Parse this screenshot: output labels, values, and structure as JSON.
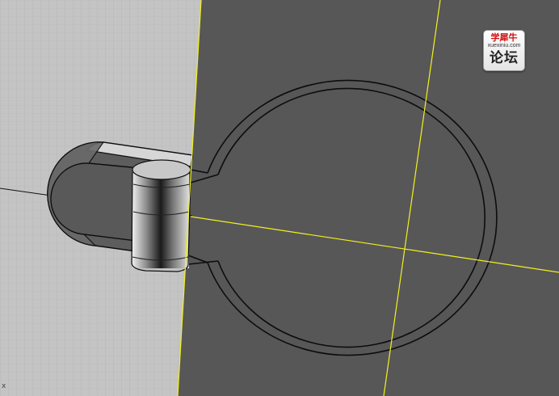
{
  "watermark": {
    "top_text": "学犀牛",
    "url_text": "xuexiniu.com",
    "bottom_text": "论坛"
  },
  "viewport": {
    "axis_indicator": "x",
    "colors": {
      "cutting_plane": "#c4c4c4",
      "grid_line": "#b0b0b0",
      "background": "#575757",
      "construction_line": "#f2f21e",
      "outline": "#0d0d0d",
      "axis_line": "#111111"
    }
  }
}
